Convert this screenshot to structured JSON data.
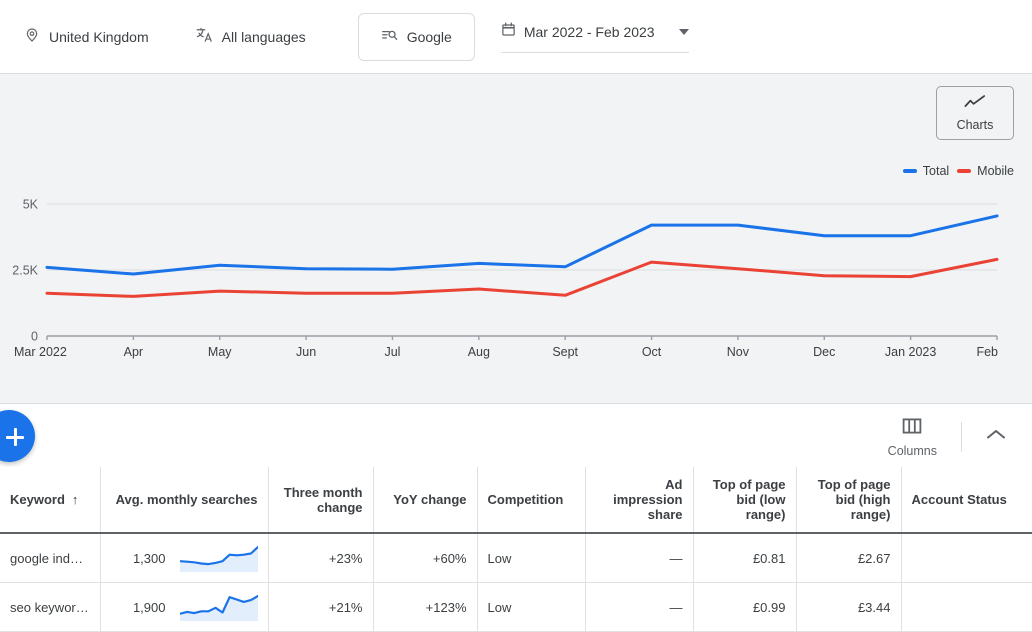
{
  "toolbar": {
    "location": {
      "label": "United Kingdom",
      "icon": "location-pin-icon"
    },
    "language": {
      "label": "All languages",
      "icon": "translate-icon"
    },
    "network": {
      "label": "Google",
      "icon": "search-network-icon"
    },
    "date_range": {
      "value": "Mar 2022 - Feb 2023",
      "icon": "calendar-icon",
      "dropdown_icon": "chevron-down-icon"
    }
  },
  "chart_panel": {
    "charts_button": {
      "label": "Charts",
      "icon": "line-chart-icon"
    },
    "legend": [
      {
        "label": "Total",
        "color": "#1a73e8"
      },
      {
        "label": "Mobile",
        "color": "#ea4335"
      }
    ]
  },
  "chart_data": {
    "type": "line",
    "title": "",
    "xlabel": "",
    "ylabel": "",
    "ylim": [
      0,
      5000
    ],
    "yticks": [
      0,
      2500,
      5000
    ],
    "ytick_labels": [
      "0",
      "2.5K",
      "5K"
    ],
    "grid": true,
    "legend_position": "top-right",
    "categories": [
      "Mar 2022",
      "Apr",
      "May",
      "Jun",
      "Jul",
      "Aug",
      "Sept",
      "Oct",
      "Nov",
      "Dec",
      "Jan 2023",
      "Feb"
    ],
    "series": [
      {
        "name": "Total",
        "color": "#1a73e8",
        "values": [
          2600,
          2350,
          2680,
          2550,
          2530,
          2750,
          2620,
          4200,
          4200,
          3800,
          3800,
          4550
        ]
      },
      {
        "name": "Mobile",
        "color": "#ea4335",
        "values": [
          1620,
          1500,
          1700,
          1620,
          1620,
          1780,
          1540,
          2800,
          2550,
          2280,
          2250,
          2900
        ]
      }
    ]
  },
  "table_tools": {
    "columns_button": {
      "label": "Columns",
      "icon": "columns-icon"
    },
    "collapse_button": {
      "icon": "chevron-up-icon"
    },
    "add_button": {
      "icon": "plus-icon",
      "color": "#1a73e8"
    }
  },
  "table": {
    "columns": [
      {
        "label": "Keyword",
        "align": "left",
        "sorted": true,
        "sort_icon": "arrow-up-icon"
      },
      {
        "label": "Avg. monthly searches",
        "align": "right"
      },
      {
        "label": "Three month change",
        "align": "right"
      },
      {
        "label": "YoY change",
        "align": "right"
      },
      {
        "label": "Competition",
        "align": "left"
      },
      {
        "label": "Ad impression share",
        "align": "right"
      },
      {
        "label": "Top of page bid (low range)",
        "align": "right"
      },
      {
        "label": "Top of page bid (high range)",
        "align": "right"
      },
      {
        "label": "Account Status",
        "align": "left"
      }
    ],
    "rows": [
      {
        "keyword": "google indexi…",
        "avg_monthly_searches": "1,300",
        "sparkline": [
          30,
          28,
          26,
          22,
          20,
          24,
          30,
          52,
          50,
          52,
          56,
          78
        ],
        "three_month_change": "+23%",
        "yoy_change": "+60%",
        "competition": "Low",
        "ad_impression_share": "—",
        "top_of_page_bid_low": "£0.81",
        "top_of_page_bid_high": "£2.67",
        "account_status": ""
      },
      {
        "keyword": "seo keyword …",
        "avg_monthly_searches": "1,900",
        "sparkline": [
          18,
          24,
          20,
          26,
          26,
          38,
          22,
          74,
          66,
          58,
          64,
          78
        ],
        "three_month_change": "+21%",
        "yoy_change": "+123%",
        "competition": "Low",
        "ad_impression_share": "—",
        "top_of_page_bid_low": "£0.99",
        "top_of_page_bid_high": "£3.44",
        "account_status": ""
      }
    ]
  }
}
